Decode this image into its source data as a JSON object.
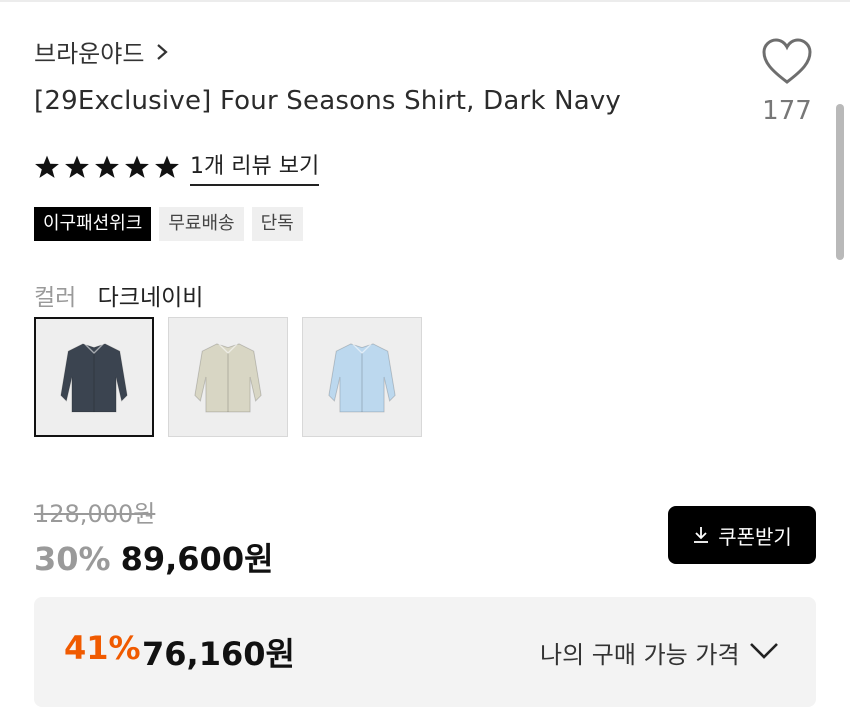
{
  "brand": {
    "name": "브라운야드"
  },
  "product": {
    "title": "[29Exclusive] Four Seasons Shirt, Dark Navy"
  },
  "like": {
    "count": "177"
  },
  "rating": {
    "stars": 5,
    "review_link": "1개 리뷰 보기"
  },
  "badges": [
    {
      "label": "이구패션위크",
      "style": "dark"
    },
    {
      "label": "무료배송",
      "style": "light"
    },
    {
      "label": "단독",
      "style": "light"
    }
  ],
  "color": {
    "label": "컬러",
    "selected": "다크네이비",
    "swatches": [
      {
        "shirt_color": "#3b4450",
        "selected": true
      },
      {
        "shirt_color": "#d8d6c4",
        "selected": false
      },
      {
        "shirt_color": "#bcd8ee",
        "selected": false
      }
    ]
  },
  "price": {
    "original": "128,000원",
    "discount_pct": "30%",
    "sale": "89,600원",
    "coupon_button": "쿠폰받기"
  },
  "my_price": {
    "discount_pct": "41%",
    "price": "76,160원",
    "label": "나의 구매 가능 가격"
  },
  "colors": {
    "accent_orange": "#f05a00",
    "dark": "#000000",
    "muted": "#9a9a9a"
  },
  "icons": {
    "brand_chevron": "chevron-right-icon",
    "like": "heart-icon",
    "coupon": "download-icon",
    "dropdown": "chevron-down-icon"
  }
}
